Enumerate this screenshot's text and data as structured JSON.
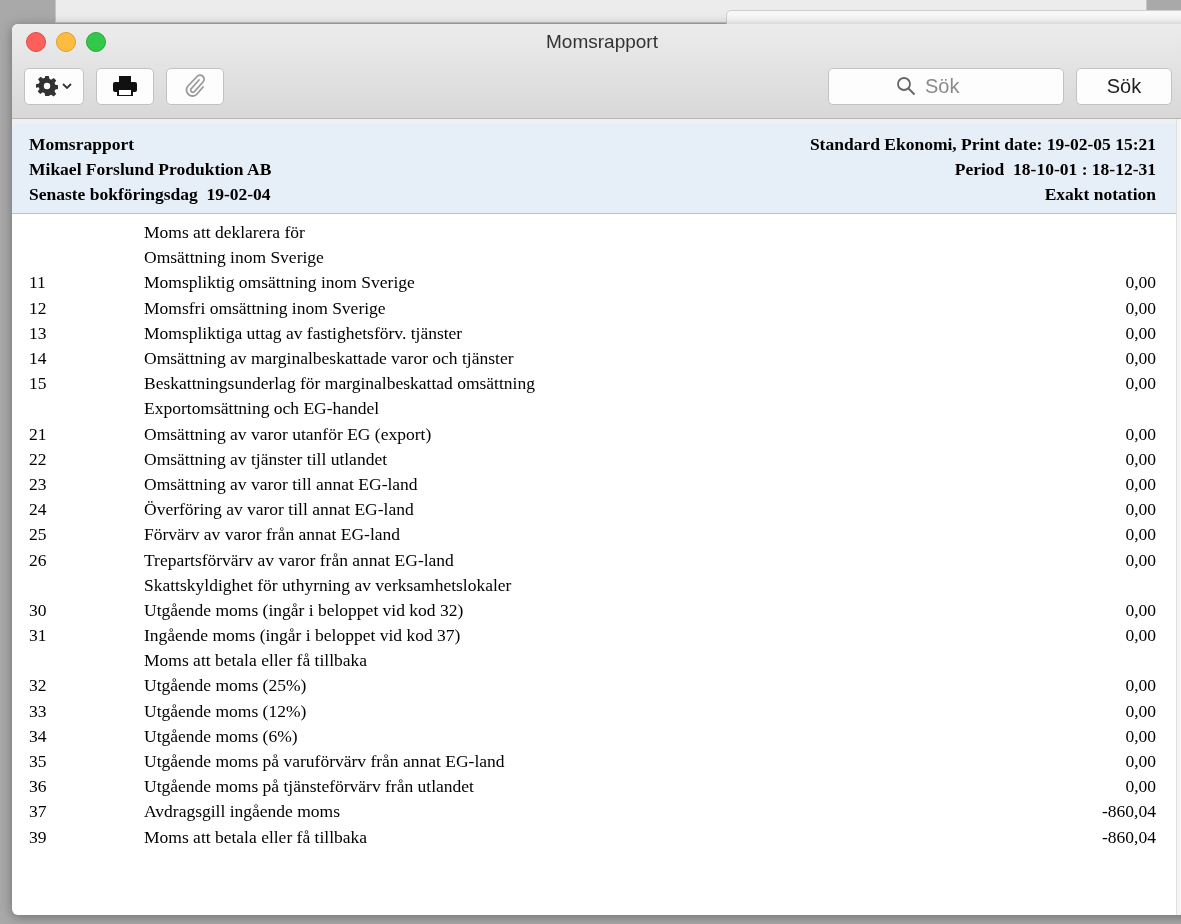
{
  "window": {
    "title": "Momsrapport"
  },
  "toolbar": {
    "search": {
      "placeholder": "Sök"
    },
    "search_button": "Sök"
  },
  "header": {
    "left": [
      "Momsrapport",
      "Mikael Forslund Produktion AB",
      "Senaste bokföringsdag  19-02-04"
    ],
    "right": [
      "Standard Ekonomi, Print date: 19-02-05 15:21",
      "Period  18-10-01 : 18-12-31",
      "Exakt notation"
    ]
  },
  "rows": [
    {
      "kind": "heading",
      "label": "Moms att deklarera för"
    },
    {
      "kind": "heading",
      "label": "Omsättning inom Sverige"
    },
    {
      "kind": "line",
      "code": "11",
      "label": "Momspliktig omsättning inom Sverige",
      "value": "0,00"
    },
    {
      "kind": "line",
      "code": "12",
      "label": "Momsfri omsättning inom Sverige",
      "value": "0,00"
    },
    {
      "kind": "line",
      "code": "13",
      "label": "Momspliktiga uttag av fastighetsförv. tjänster",
      "value": "0,00"
    },
    {
      "kind": "line",
      "code": "14",
      "label": "Omsättning av marginalbeskattade varor och tjänster",
      "value": "0,00"
    },
    {
      "kind": "line",
      "code": "15",
      "label": "Beskattningsunderlag för marginalbeskattad omsättning",
      "value": "0,00"
    },
    {
      "kind": "heading",
      "label": "Exportomsättning och EG-handel"
    },
    {
      "kind": "line",
      "code": "21",
      "label": "Omsättning av varor utanför EG (export)",
      "value": "0,00"
    },
    {
      "kind": "line",
      "code": "22",
      "label": "Omsättning av tjänster till utlandet",
      "value": "0,00"
    },
    {
      "kind": "line",
      "code": "23",
      "label": "Omsättning av varor till annat EG-land",
      "value": "0,00"
    },
    {
      "kind": "line",
      "code": "24",
      "label": "Överföring av varor till annat EG-land",
      "value": "0,00"
    },
    {
      "kind": "line",
      "code": "25",
      "label": "Förvärv av varor från annat EG-land",
      "value": "0,00"
    },
    {
      "kind": "line",
      "code": "26",
      "label": "Trepartsförvärv av varor från annat EG-land",
      "value": "0,00"
    },
    {
      "kind": "heading",
      "label": "Skattskyldighet för uthyrning av verksamhetslokaler"
    },
    {
      "kind": "line",
      "code": "30",
      "label": "Utgående moms (ingår i beloppet vid kod 32)",
      "value": "0,00"
    },
    {
      "kind": "line",
      "code": "31",
      "label": "Ingående moms (ingår i beloppet vid kod 37)",
      "value": "0,00"
    },
    {
      "kind": "heading",
      "label": "Moms att betala eller få tillbaka"
    },
    {
      "kind": "line",
      "code": "32",
      "label": "Utgående moms (25%)",
      "value": "0,00"
    },
    {
      "kind": "line",
      "code": "33",
      "label": "Utgående moms (12%)",
      "value": "0,00"
    },
    {
      "kind": "line",
      "code": "34",
      "label": "Utgående moms (6%)",
      "value": "0,00"
    },
    {
      "kind": "line",
      "code": "35",
      "label": "Utgående moms på varuförvärv från annat EG-land",
      "value": "0,00"
    },
    {
      "kind": "line",
      "code": "36",
      "label": "Utgående moms på tjänsteförvärv från utlandet",
      "value": "0,00"
    },
    {
      "kind": "line",
      "code": "37",
      "label": "Avdragsgill ingående moms",
      "value": "-860,04"
    },
    {
      "kind": "line",
      "code": "39",
      "label": "Moms att betala eller få tillbaka",
      "value": "-860,04"
    }
  ]
}
